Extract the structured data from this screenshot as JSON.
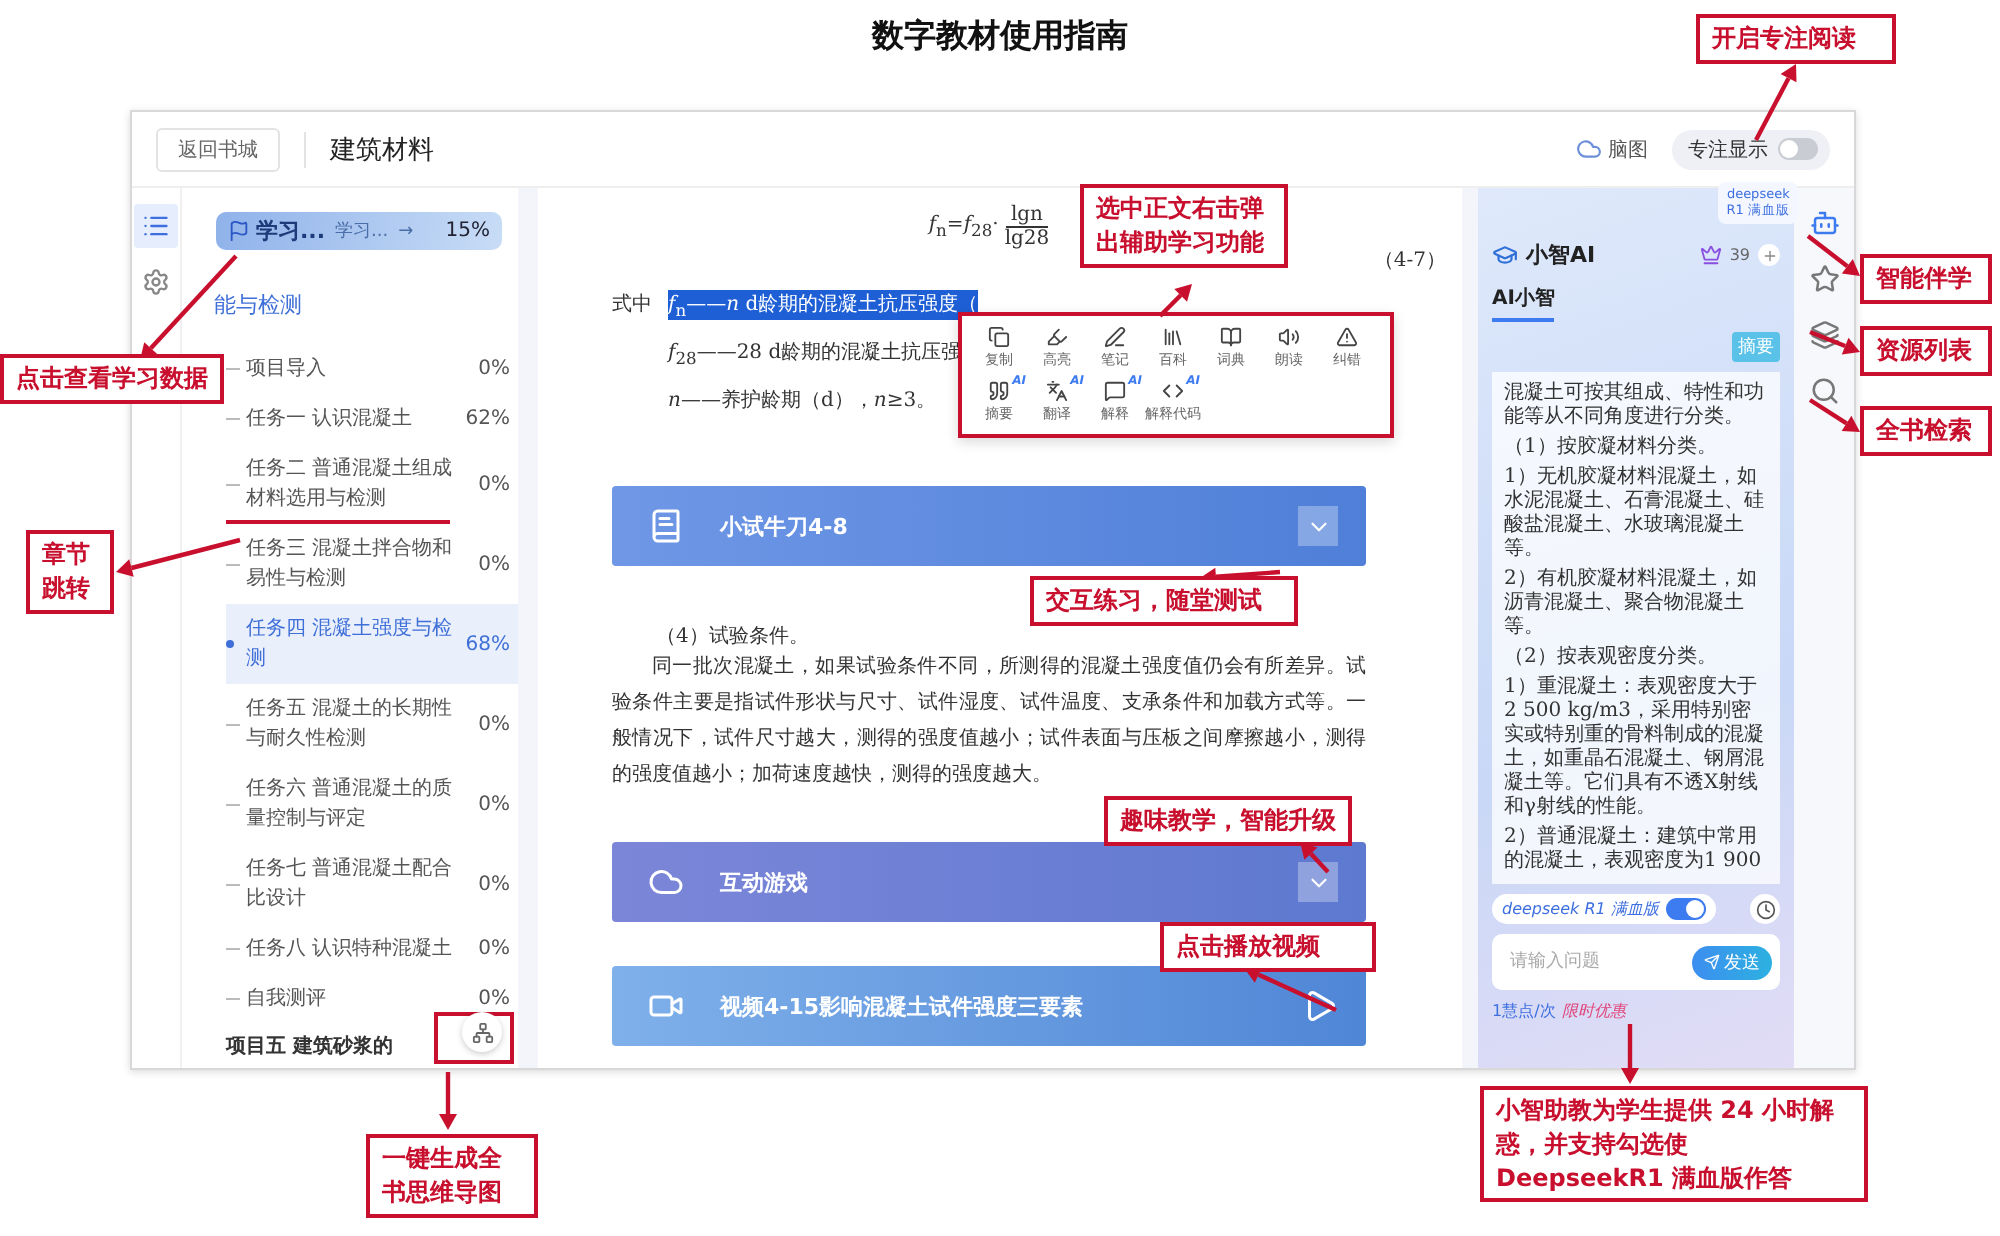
{
  "page_title": "数字教材使用指南",
  "header": {
    "back_button": "返回书城",
    "book_title": "建筑材料",
    "mindmap_label": "脑图",
    "focus_toggle": {
      "label": "专注显示",
      "on": false
    }
  },
  "left_rail": [
    {
      "kind": "contents",
      "selected": true
    },
    {
      "kind": "settings",
      "selected": false
    }
  ],
  "study_card": {
    "label": "学习...",
    "sublabel": "学习...",
    "arrow": "→",
    "progress": "15%"
  },
  "toc": {
    "section_heading": "能与检测",
    "items": [
      {
        "title": "项目导入",
        "progress": "0%",
        "selected": false
      },
      {
        "title": "任务一 认识混凝土",
        "progress": "62%",
        "selected": false
      },
      {
        "title": "任务二 普通混凝土组成材料选用与检测",
        "progress": "0%",
        "selected": false
      },
      {
        "title": "任务三 混凝土拌合物和易性与检测",
        "progress": "0%",
        "selected": false
      },
      {
        "title": "任务四 混凝土强度与检测",
        "progress": "68%",
        "selected": true
      },
      {
        "title": "任务五 混凝土的长期性与耐久性检测",
        "progress": "0%",
        "selected": false
      },
      {
        "title": "任务六 普通混凝土的质量控制与评定",
        "progress": "0%",
        "selected": false
      },
      {
        "title": "任务七 普通混凝土配合比设计",
        "progress": "0%",
        "selected": false
      },
      {
        "title": "任务八 认识特种混凝土",
        "progress": "0%",
        "selected": false
      },
      {
        "title": "自我测评",
        "progress": "0%",
        "selected": false
      }
    ],
    "cut_item": "项目五 建筑砂浆的"
  },
  "content": {
    "formula": {
      "lhs": "*f*$_{n}$=*f*$_{28}$·",
      "numerator": "lgn",
      "denominator": "lg28",
      "number": "（4-7）"
    },
    "where_label": "式中",
    "definitions": [
      {
        "text": "*f*$_{n}$——*n* d龄期的混凝土抗压强度（",
        "highlighted": true
      },
      {
        "text": "*f*$_{28}$——28 d龄期的混凝土抗压强",
        "highlighted": false
      },
      {
        "text": "*n*——养护龄期（d），*n*≥3。",
        "highlighted": false
      }
    ],
    "blocks": [
      {
        "kind": "exercise",
        "title": "小试牛刀4-8"
      },
      {
        "kind": "heading",
        "text": "（4）试验条件。"
      },
      {
        "kind": "paragraph",
        "text": "同一批次混凝土，如果试验条件不同，所测得的混凝土强度值仍会有所差异。试验条件主要是指试件形状与尺寸、试件湿度、试件温度、支承条件和加载方式等。一般情况下，试件尺寸越大，测得的强度值越小；试件表面与压板之间摩擦越小，测得的强度值越小；加荷速度越快，测得的强度越大。"
      },
      {
        "kind": "game",
        "title": "互动游戏"
      },
      {
        "kind": "video",
        "title": "视频4-15影响混凝土试件强度三要素"
      }
    ]
  },
  "context_menu": {
    "rows": [
      [
        {
          "label": "复制"
        },
        {
          "label": "高亮"
        },
        {
          "label": "笔记"
        },
        {
          "label": "百科"
        },
        {
          "label": "词典"
        },
        {
          "label": "朗读"
        },
        {
          "label": "纠错"
        }
      ],
      [
        {
          "label": "摘要",
          "badge": "AI"
        },
        {
          "label": "翻译",
          "badge": "AI"
        },
        {
          "label": "解释",
          "badge": "AI"
        },
        {
          "label": "解释代码",
          "badge": "AI"
        }
      ]
    ]
  },
  "ai_panel": {
    "title": "小智AI",
    "points": "39",
    "deepseek_badge": [
      "deepseek",
      "R1 满血版"
    ],
    "tabs": [
      {
        "label": "AI小智",
        "selected": true
      }
    ],
    "tag": "摘要",
    "answer": [
      "混凝土可按其组成、特性和功能等从不同角度进行分类。",
      "（1）按胶凝材料分类。",
      "1）无机胶凝材料混凝土，如水泥混凝土、石膏混凝土、硅酸盐混凝土、水玻璃混凝土等。",
      "2）有机胶凝材料混凝土，如沥青混凝土、聚合物混凝土等。",
      "（2）按表观密度分类。",
      "1）重混凝土：表观密度大于2 500 kg/m3，采用特别密实或特别重的骨料制成的混凝土，如重晶石混凝土、钢屑混凝土等。它们具有不透X射线和γ射线的性能。",
      "2）普通混凝土：建筑中常用的混凝土，表观密度为1 900"
    ],
    "model_toggle": {
      "label": "deepseek R1 满血版",
      "on": true
    },
    "input": {
      "placeholder": "请输入问题"
    },
    "send_button": "发送",
    "price": "1慧点/次",
    "promo": "限时优惠"
  },
  "right_rail": [
    {
      "kind": "companion",
      "selected": true
    },
    {
      "kind": "favorites",
      "selected": false
    },
    {
      "kind": "resources",
      "selected": false
    },
    {
      "kind": "search",
      "selected": false
    }
  ],
  "callouts": [
    "开启专注阅读",
    "选中正文右击弹出辅助学习功能",
    "点击查看学习数据",
    "章节跳转",
    "交互练习，随堂测试",
    "趣味教学，智能升级",
    "点击播放视频",
    "智能伴学",
    "资源列表",
    "全书检索",
    "一键生成全书思维导图",
    "小智助教为学生提供 24 小时解惑，并支持勾选使 DeepseekR1 满血版作答"
  ]
}
